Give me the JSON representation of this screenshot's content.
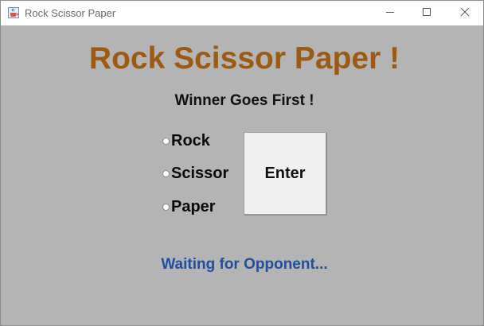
{
  "window": {
    "title": "Rock Scissor Paper",
    "icon": "java-cup-icon",
    "controls": [
      "minimize-icon",
      "maximize-icon",
      "close-icon"
    ]
  },
  "main": {
    "title": "Rock Scissor Paper !",
    "subtitle": "Winner Goes First !",
    "options": [
      {
        "label": "Rock",
        "selected": false
      },
      {
        "label": "Scissor",
        "selected": false
      },
      {
        "label": "Paper",
        "selected": false
      }
    ],
    "enter_label": "Enter",
    "status": "Waiting for Opponent..."
  },
  "colors": {
    "background": "#b4b4b4",
    "title": "#9c5a12",
    "status": "#1f4f9e",
    "button": "#f0f0f0"
  }
}
